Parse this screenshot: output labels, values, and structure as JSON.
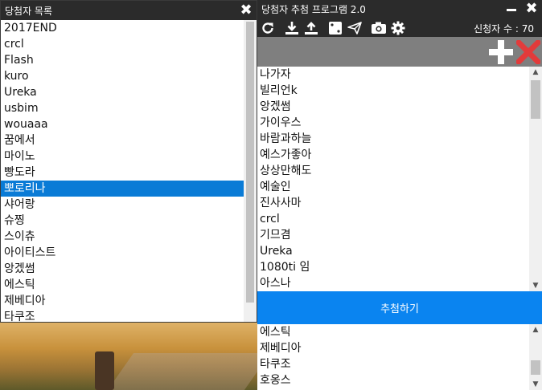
{
  "left_window": {
    "title": "당첨자 목록",
    "close_glyph": "✖",
    "items": [
      "2017END",
      "crcl",
      "Flash",
      "kuro",
      "Ureka",
      "usbim",
      "wouaaa",
      "꿈에서",
      "마이노",
      "빵도라",
      "뽀로리나",
      "샤어랑",
      "슈찡",
      "스이츄",
      "아이티스트",
      "앙겠썸",
      "에스틱",
      "제베디아",
      "타쿠조"
    ],
    "selected_index": 10
  },
  "right_window": {
    "title": "당첨자 추첨 프로그램 2.0",
    "minimize_glyph": "—",
    "close_glyph": "✖",
    "toolbar_icons": [
      "refresh-icon",
      "download-icon",
      "upload-icon",
      "dice-icon",
      "paper-plane-icon",
      "camera-icon",
      "gear-icon"
    ],
    "applicant_count_label": "신청자 수 : 70",
    "candidates": [
      "나가자",
      "빌리언k",
      "앙겠썸",
      "가이우스",
      "바람과하늘",
      "예스가좋아",
      "상상만해도",
      "예술인",
      "진사사마",
      "crcl",
      "기므겸",
      "Ureka",
      "1080ti 임",
      "아스나"
    ],
    "draw_button_label": "추첨하기",
    "results": [
      "에스틱",
      "제베디아",
      "타쿠조",
      "호옹스"
    ],
    "colors": {
      "title_bar": "#2b2b2b",
      "action_bar": "#7f7f7f",
      "draw_button": "#0a84f0",
      "selection": "#0a7bd6",
      "delete_icon": "#e23b3b"
    }
  }
}
